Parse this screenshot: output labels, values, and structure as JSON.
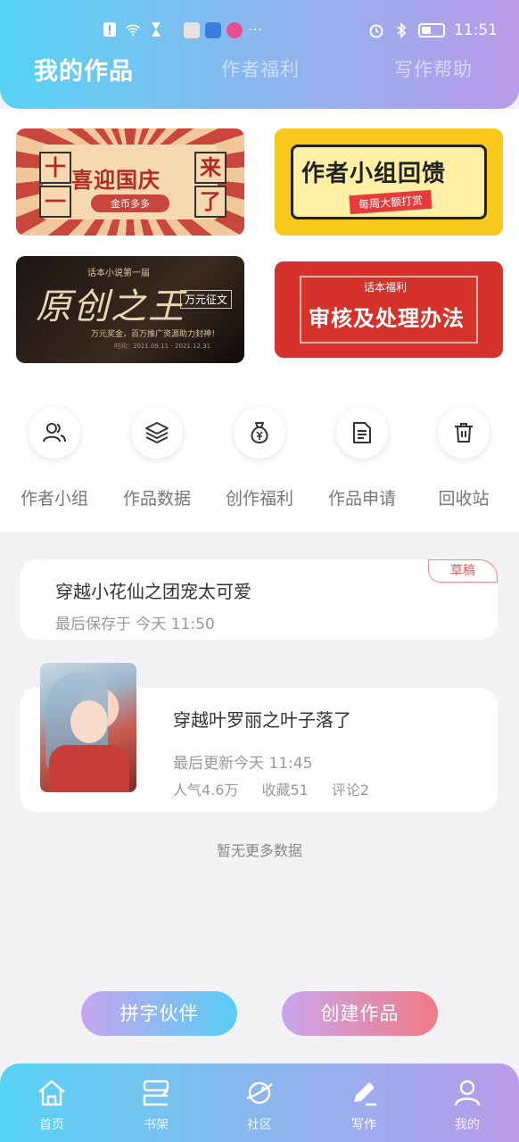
{
  "status_bar": {
    "time": "11:51",
    "wifi_label": "6"
  },
  "header": {
    "tabs": [
      {
        "label": "我的作品",
        "active": true
      },
      {
        "label": "作者福利",
        "active": false
      },
      {
        "label": "写作帮助",
        "active": false
      }
    ]
  },
  "banners": [
    {
      "title": "喜迎国庆",
      "subtitle": "金币多多",
      "side_chars": [
        "十",
        "一",
        "来",
        "了"
      ]
    },
    {
      "title": "作者小组回馈",
      "subtitle": "每周大额打赏"
    },
    {
      "top_line": "话本小说第一届",
      "title": "原创之王",
      "tag": "万元征文",
      "line": "万元奖金，百万推广资源助力封神！",
      "date": "时间：2021.09.11 - 2021.12.31"
    },
    {
      "top_line": "话本福利",
      "title": "审核及处理办法"
    }
  ],
  "quick_menu": [
    {
      "label": "作者小组",
      "icon": "users-icon"
    },
    {
      "label": "作品数据",
      "icon": "layers-icon"
    },
    {
      "label": "创作福利",
      "icon": "money-bag-icon"
    },
    {
      "label": "作品申请",
      "icon": "document-icon"
    },
    {
      "label": "回收站",
      "icon": "trash-icon"
    }
  ],
  "draft": {
    "badge": "草稿",
    "title": "穿越小花仙之团宠太可爱",
    "saved": "最后保存于 今天 11:50"
  },
  "work": {
    "title": "穿越叶罗丽之叶子落了",
    "updated": "最后更新今天 11:45",
    "popularity": "人气4.6万",
    "favorites": "收藏51",
    "comments": "评论2"
  },
  "no_more": "暂无更多数据",
  "actions": {
    "partner": "拼字伙伴",
    "create": "创建作品"
  },
  "bottom_nav": [
    {
      "label": "首页",
      "icon": "home-icon",
      "active": false
    },
    {
      "label": "书架",
      "icon": "bookshelf-icon",
      "active": false
    },
    {
      "label": "社区",
      "icon": "planet-icon",
      "active": false
    },
    {
      "label": "写作",
      "icon": "pen-icon",
      "active": true
    },
    {
      "label": "我的",
      "icon": "user-icon",
      "active": false
    }
  ]
}
